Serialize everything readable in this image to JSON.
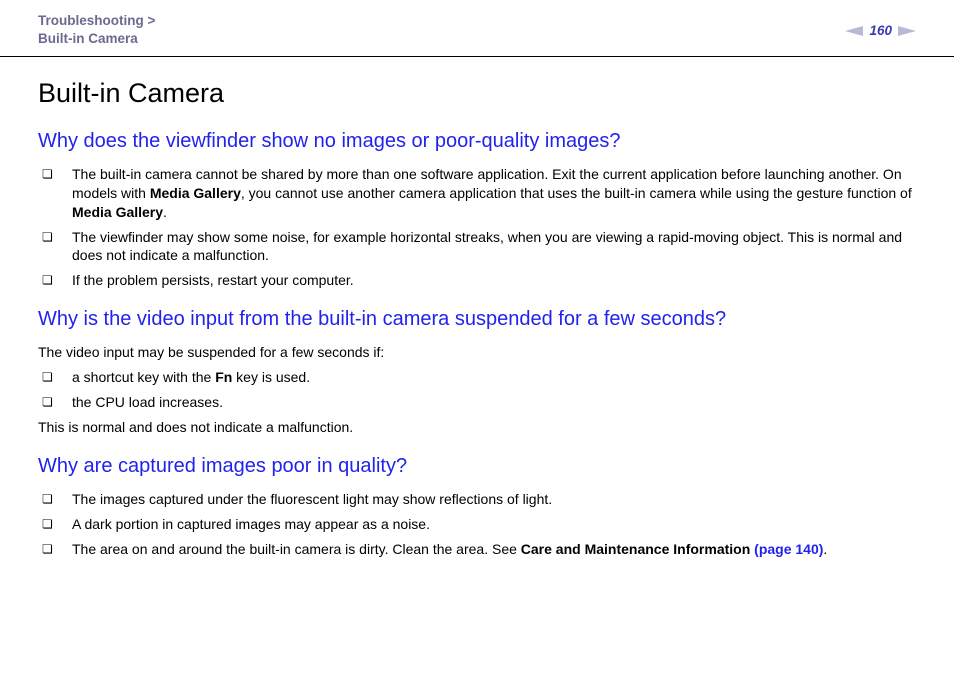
{
  "header": {
    "breadcrumb_section": "Troubleshooting",
    "breadcrumb_separator": ">",
    "breadcrumb_page": "Built-in Camera",
    "page_number": "160"
  },
  "title": "Built-in Camera",
  "sections": [
    {
      "heading": "Why does the viewfinder show no images or poor-quality images?",
      "items": [
        {
          "pre": "The built-in camera cannot be shared by more than one software application. Exit the current application before launching another. On models with ",
          "bold1": "Media Gallery",
          "mid": ", you cannot use another camera application that uses the built-in camera while using the gesture function of ",
          "bold2": "Media Gallery",
          "post": "."
        },
        {
          "text": "The viewfinder may show some noise, for example horizontal streaks, when you are viewing a rapid-moving object. This is normal and does not indicate a malfunction."
        },
        {
          "text": "If the problem persists, restart your computer."
        }
      ]
    },
    {
      "heading": "Why is the video input from the built-in camera suspended for a few seconds?",
      "intro": "The video input may be suspended for a few seconds if:",
      "items": [
        {
          "pre": "a shortcut key with the ",
          "bold1": "Fn",
          "post": " key is used."
        },
        {
          "text": "the CPU load increases."
        }
      ],
      "outro": "This is normal and does not indicate a malfunction."
    },
    {
      "heading": "Why are captured images poor in quality?",
      "items": [
        {
          "text": "The images captured under the fluorescent light may show reflections of light."
        },
        {
          "text": "A dark portion in captured images may appear as a noise."
        },
        {
          "pre": "The area on and around the built-in camera is dirty. Clean the area. See ",
          "bold1": "Care and Maintenance Information ",
          "link": "(page 140)",
          "post": "."
        }
      ]
    }
  ]
}
